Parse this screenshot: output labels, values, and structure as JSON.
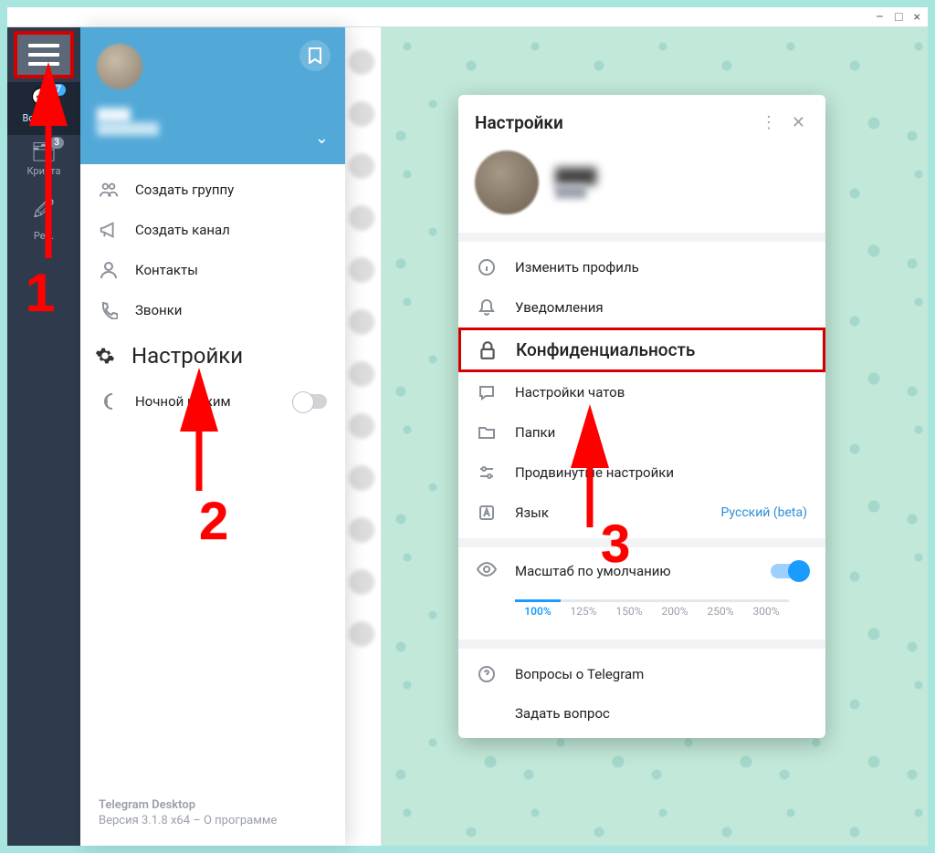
{
  "window": {
    "minimize": "–",
    "maximize": "□",
    "close": "×"
  },
  "sidebar": {
    "items": [
      {
        "label": "Все чаты",
        "badge": "87"
      },
      {
        "label": "Крипта",
        "badge": "3"
      },
      {
        "label": "Ред."
      }
    ]
  },
  "drawer": {
    "create_group": "Создать группу",
    "create_channel": "Создать канал",
    "contacts": "Контакты",
    "calls": "Звонки",
    "settings": "Настройки",
    "night_mode": "Ночной режим",
    "app_name": "Telegram Desktop",
    "version_line": "Версия 3.1.8 x64 – О программе"
  },
  "settings": {
    "title": "Настройки",
    "edit_profile": "Изменить профиль",
    "notifications": "Уведомления",
    "privacy": "Конфиденциальность",
    "chat_settings": "Настройки чатов",
    "folders": "Папки",
    "advanced": "Продвинутые настройки",
    "language": "Язык",
    "language_value": "Русский (beta)",
    "scale_label": "Масштаб по умолчанию",
    "scale_values": [
      "100%",
      "125%",
      "150%",
      "200%",
      "250%",
      "300%"
    ],
    "faq": "Вопросы о Telegram",
    "ask": "Задать вопрос"
  },
  "annotations": {
    "n1": "1",
    "n2": "2",
    "n3": "3"
  }
}
